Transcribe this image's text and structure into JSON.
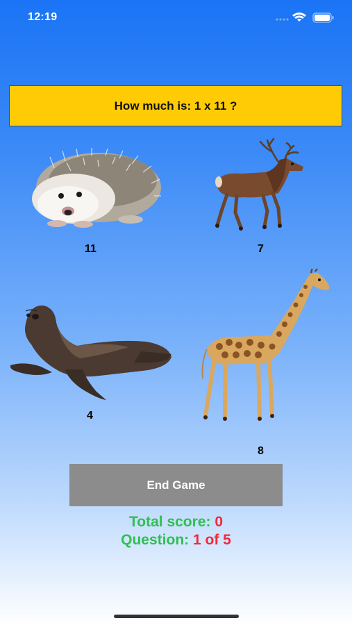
{
  "status_bar": {
    "time": "12:19"
  },
  "question": {
    "text": "How much is: 1 x 11 ?"
  },
  "answers": [
    {
      "animal": "hedgehog",
      "value": "11"
    },
    {
      "animal": "deer",
      "value": "7"
    },
    {
      "animal": "sea-lion",
      "value": "4"
    },
    {
      "animal": "giraffe",
      "value": "8"
    }
  ],
  "end_button": {
    "label": "End Game"
  },
  "score": {
    "label": "Total score:",
    "value": "0"
  },
  "progress": {
    "label": "Question:",
    "value": "1 of 5"
  },
  "colors": {
    "question_bg": "#ffcb05",
    "button_bg": "#8c8c8c",
    "label_green": "#2fbf50",
    "value_red": "#f2293a"
  }
}
